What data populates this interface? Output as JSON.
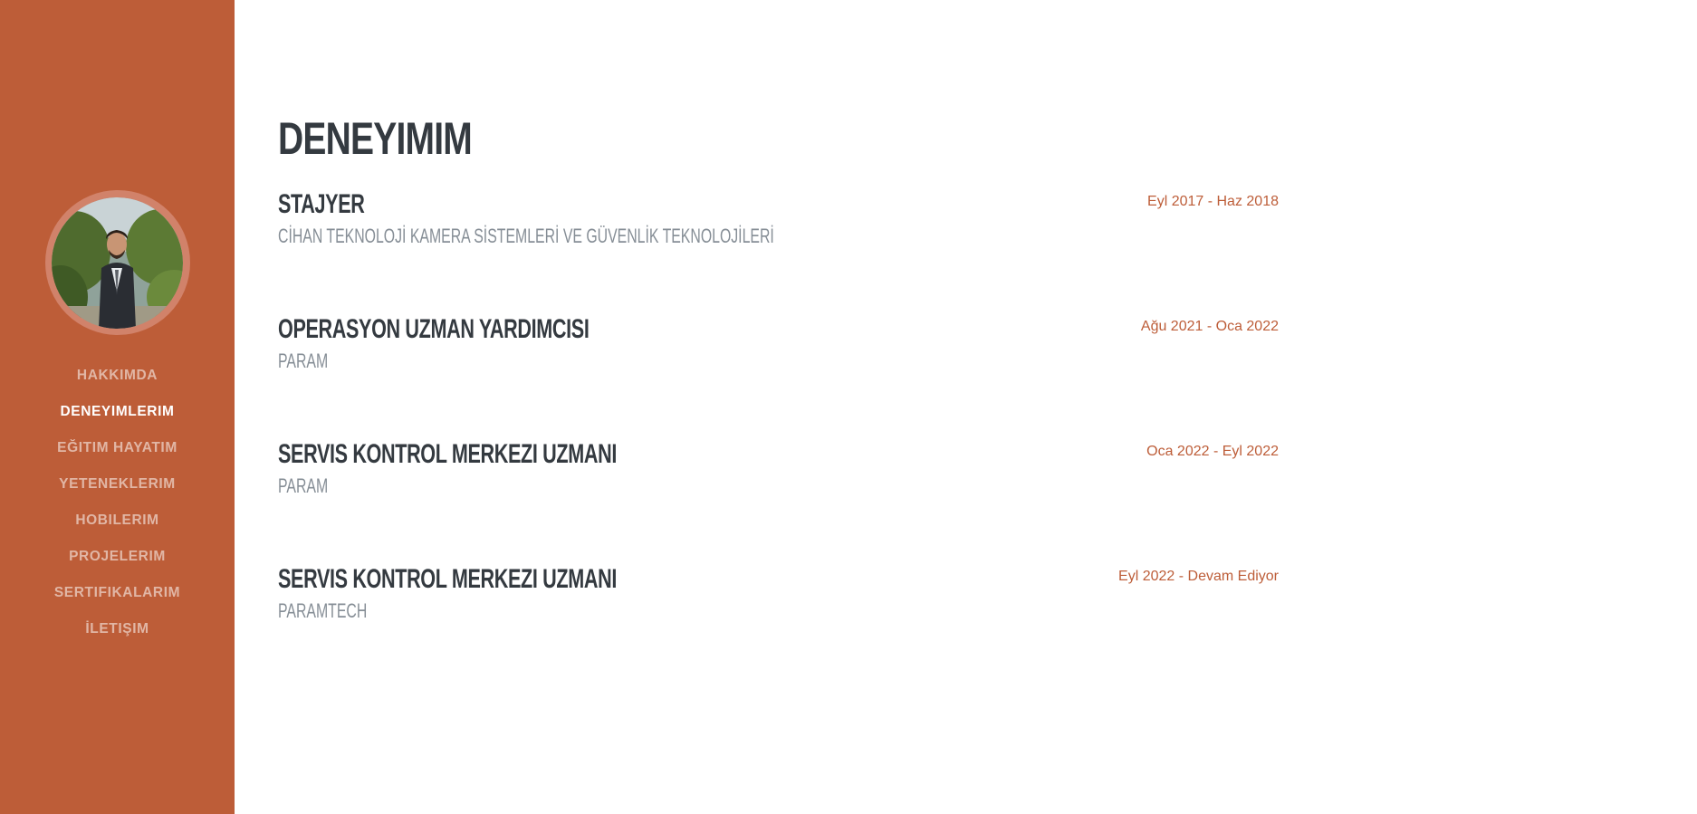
{
  "colors": {
    "sidebar_bg": "#bd5d38",
    "accent": "#bd5d38",
    "heading": "#343a40",
    "subheading": "#868e96"
  },
  "sidebar": {
    "avatar_alt": "profile-photo",
    "nav": [
      {
        "label": "HAKKIMDA",
        "active": false
      },
      {
        "label": "DENEYIMLERIM",
        "active": true
      },
      {
        "label": "EĞITIM HAYATIM",
        "active": false
      },
      {
        "label": "YETENEKLERIM",
        "active": false
      },
      {
        "label": "HOBILERIM",
        "active": false
      },
      {
        "label": "PROJELERIM",
        "active": false
      },
      {
        "label": "SERTIFIKALARIM",
        "active": false
      },
      {
        "label": "İLETIŞIM",
        "active": false
      }
    ]
  },
  "main": {
    "title": "DENEYIMIM",
    "experiences": [
      {
        "title": "STAJYER",
        "company": "CİHAN TEKNOLOJİ KAMERA SİSTEMLERİ VE GÜVENLİK TEKNOLOJİLERİ",
        "date": "Eyl 2017 - Haz 2018"
      },
      {
        "title": "OPERASYON UZMAN YARDIMCISI",
        "company": "PARAM",
        "date": "Ağu 2021 - Oca 2022"
      },
      {
        "title": "SERVIS KONTROL MERKEZI UZMANI",
        "company": "PARAM",
        "date": "Oca 2022 - Eyl 2022"
      },
      {
        "title": "SERVIS KONTROL MERKEZI UZMANI",
        "company": "PARAMTECH",
        "date": "Eyl 2022 - Devam Ediyor"
      }
    ]
  }
}
